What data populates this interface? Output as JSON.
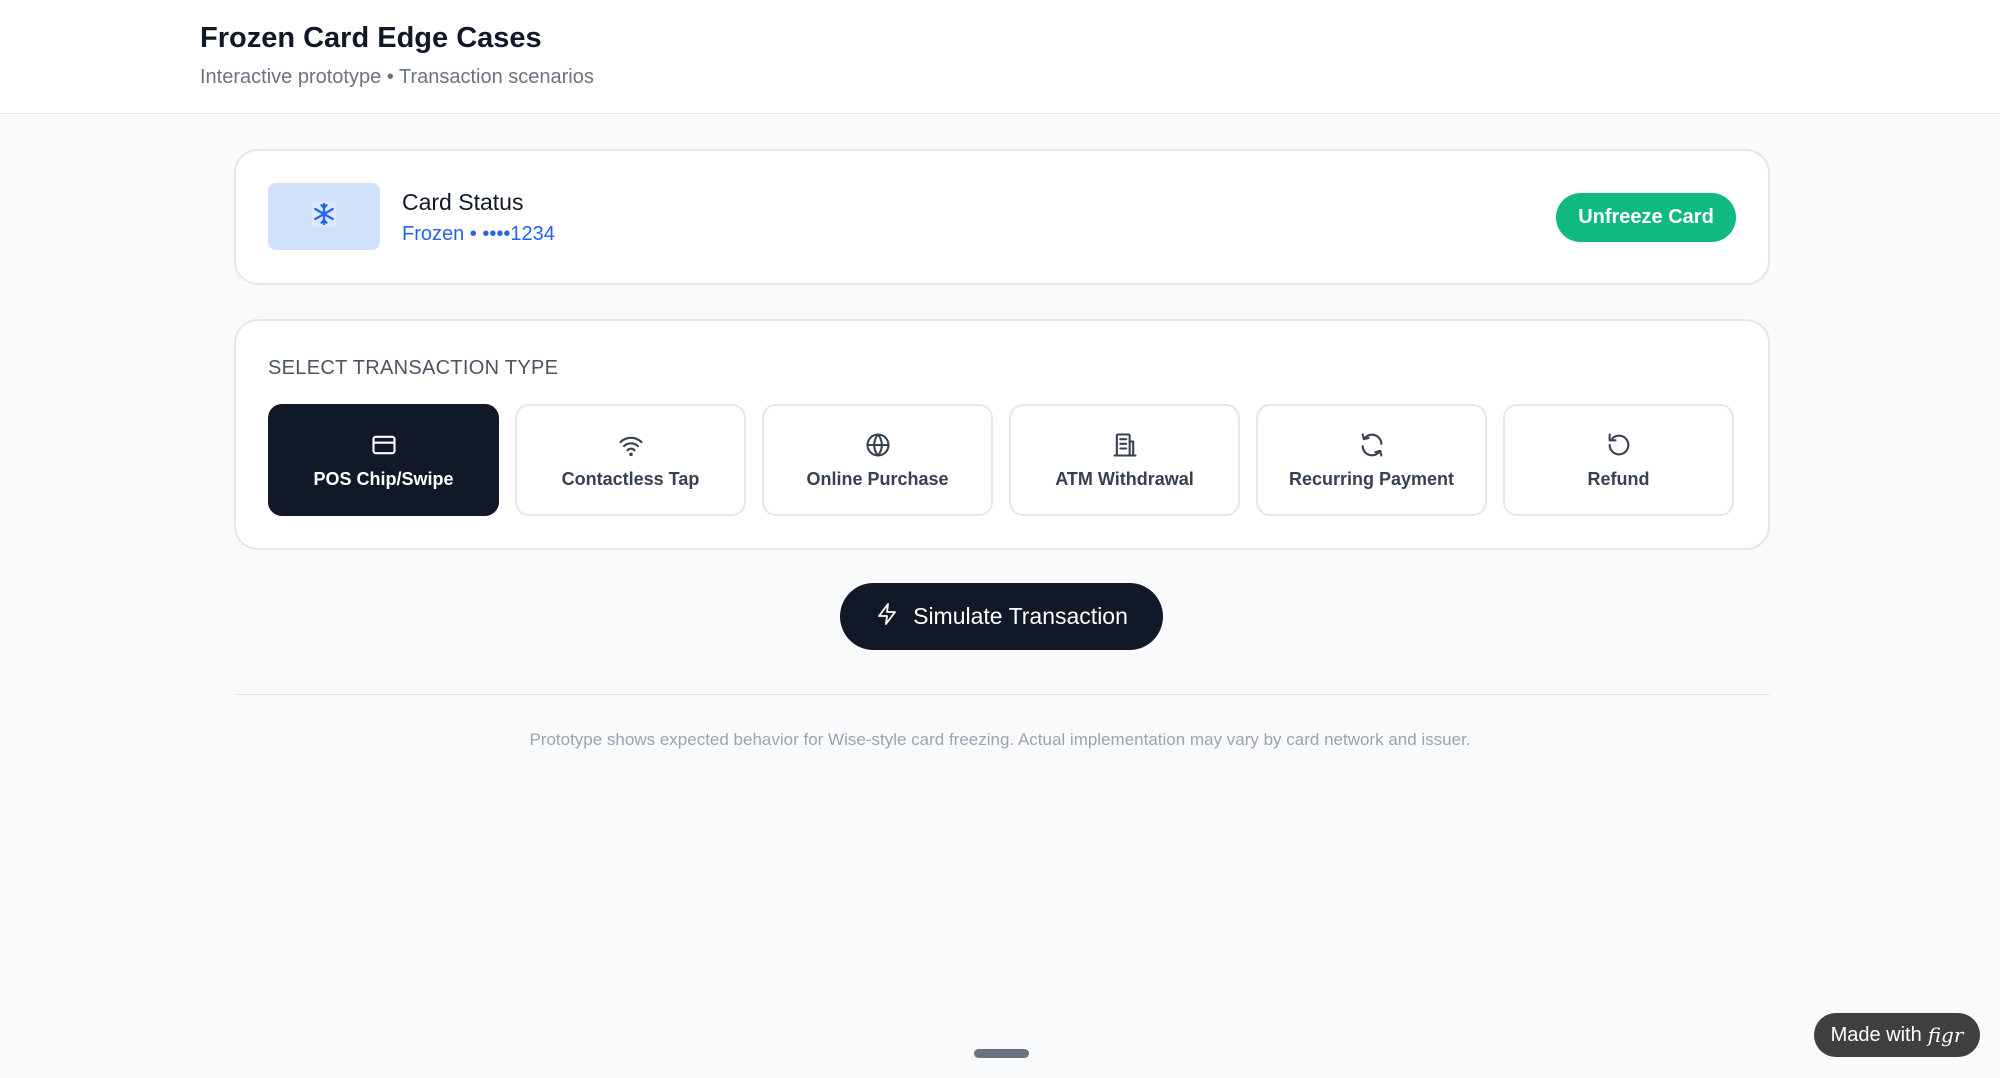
{
  "header": {
    "title": "Frozen Card Edge Cases",
    "subtitle": "Interactive prototype • Transaction scenarios"
  },
  "card_status": {
    "icon": "snowflake-icon",
    "title": "Card Status",
    "subtitle": "Frozen • ••••1234",
    "action_label": "Unfreeze Card",
    "action_color": "#10b981"
  },
  "transaction_types": {
    "heading": "SELECT TRANSACTION TYPE",
    "selected": "POS Chip/Swipe",
    "items": [
      {
        "label": "POS Chip/Swipe",
        "icon": "credit-card-icon"
      },
      {
        "label": "Contactless Tap",
        "icon": "wifi-icon"
      },
      {
        "label": "Online Purchase",
        "icon": "globe-icon"
      },
      {
        "label": "ATM Withdrawal",
        "icon": "atm-building-icon"
      },
      {
        "label": "Recurring Payment",
        "icon": "refresh-icon"
      },
      {
        "label": "Refund",
        "icon": "rotate-ccw-icon"
      }
    ]
  },
  "simulate": {
    "label": "Simulate Transaction",
    "icon": "lightning-icon"
  },
  "footnote": "Prototype shows expected behavior for Wise-style card freezing. Actual implementation may vary by card network and issuer.",
  "badge": {
    "prefix": "Made with",
    "brand": "figr"
  },
  "colors": {
    "accent_dark": "#111827",
    "frozen_blue": "#2563eb",
    "success_green": "#10b981"
  }
}
